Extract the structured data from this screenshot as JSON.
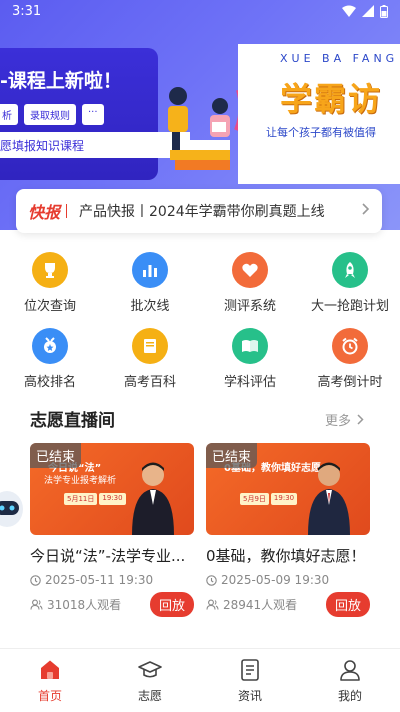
{
  "status_bar": {
    "time": "3:31"
  },
  "banner": {
    "slide_a": {
      "headline": "-课程上新啦！",
      "chips": [
        "析",
        "录取规则",
        "···"
      ],
      "subtitle": "愿填报知识课程"
    },
    "slide_b": {
      "pinyin": "XUE BA FANG",
      "title": "学霸访",
      "subtitle": "让每个孩子都有被值得"
    }
  },
  "ticker": {
    "badge": "快报",
    "text": "产品快报丨2024年学霸带你刷真题上线"
  },
  "grid": [
    {
      "label": "位次查询",
      "icon": "trophy-icon",
      "color": "#f5b014"
    },
    {
      "label": "批次线",
      "icon": "bar-chart-icon",
      "color": "#3a8ef6"
    },
    {
      "label": "测评系统",
      "icon": "heart-icon",
      "color": "#f26b3a"
    },
    {
      "label": "大一抢跑计划",
      "icon": "rocket-icon",
      "color": "#27c08a"
    },
    {
      "label": "高校排名",
      "icon": "medal-icon",
      "color": "#3a8ef6"
    },
    {
      "label": "高考百科",
      "icon": "book-icon",
      "color": "#f5b014"
    },
    {
      "label": "学科评估",
      "icon": "open-book-icon",
      "color": "#27c08a"
    },
    {
      "label": "高考倒计时",
      "icon": "alarm-clock-icon",
      "color": "#f26b3a"
    }
  ],
  "live": {
    "title": "志愿直播间",
    "more": "更多",
    "cards": [
      {
        "status": "已结束",
        "thumb_caption_1": "今日说“法”",
        "thumb_caption_2": "法学专业报考解析",
        "thumb_date": [
          "5月11日",
          "19:30"
        ],
        "title": "今日说“法”-法学专业...",
        "date": "2025-05-11 19:30",
        "views": "31018人观看",
        "action": "回放"
      },
      {
        "status": "已结束",
        "thumb_caption_1": "0基础，教你填好志愿",
        "thumb_caption_2": "",
        "thumb_date": [
          "5月9日",
          "19:30"
        ],
        "title": "0基础，教你填好志愿！",
        "date": "2025-05-09 19:30",
        "views": "28941人观看",
        "action": "回放"
      }
    ]
  },
  "tabbar": [
    {
      "label": "首页",
      "icon": "home-icon",
      "active": true
    },
    {
      "label": "志愿",
      "icon": "graduation-cap-icon",
      "active": false
    },
    {
      "label": "资讯",
      "icon": "document-icon",
      "active": false
    },
    {
      "label": "我的",
      "icon": "user-icon",
      "active": false
    }
  ],
  "colors": {
    "accent": "#e63c2f",
    "banner": "#5b5cf0"
  }
}
